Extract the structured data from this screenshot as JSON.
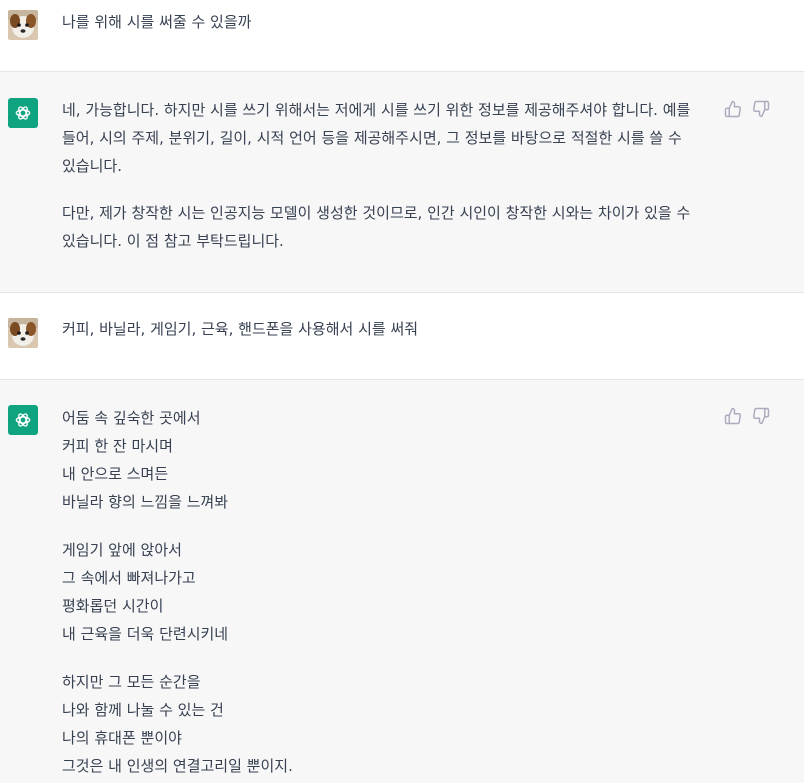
{
  "messages": [
    {
      "role": "user",
      "text": "나를 위해 시를 써줄 수 있을까"
    },
    {
      "role": "assistant",
      "paragraphs": [
        "네, 가능합니다. 하지만 시를 쓰기 위해서는 저에게 시를 쓰기 위한 정보를 제공해주셔야 합니다. 예를 들어, 시의 주제, 분위기, 길이, 시적 언어 등을 제공해주시면, 그 정보를 바탕으로 적절한 시를 쓸 수 있습니다.",
        "다만, 제가 창작한 시는 인공지능 모델이 생성한 것이므로, 인간 시인이 창작한 시와는 차이가 있을 수 있습니다. 이 점 참고 부탁드립니다."
      ]
    },
    {
      "role": "user",
      "text": "커피, 바닐라, 게임기, 근육, 핸드폰을 사용해서 시를 써줘"
    },
    {
      "role": "assistant",
      "stanzas": [
        [
          "어둠 속 깊숙한 곳에서",
          "커피 한 잔 마시며",
          "내 안으로 스며든",
          "바닐라 향의 느낌을 느껴봐"
        ],
        [
          "게임기 앞에 앉아서",
          "그 속에서 빠져나가고",
          "평화롭던 시간이",
          "내 근육을 더욱 단련시키네"
        ],
        [
          "하지만 그 모든 순간을",
          "나와 함께 나눌 수 있는 건",
          "나의 휴대폰 뿐이야",
          "그것은 내 인생의 연결고리일 뿐이지."
        ]
      ]
    }
  ],
  "icons": {
    "user_avatar": "dog-avatar",
    "assistant_avatar": "openai-logo-icon",
    "like": "thumbs-up-icon",
    "dislike": "thumbs-down-icon"
  },
  "colors": {
    "assistant_bg": "#f7f7f8",
    "brand": "#10a37f",
    "text": "#374151"
  }
}
